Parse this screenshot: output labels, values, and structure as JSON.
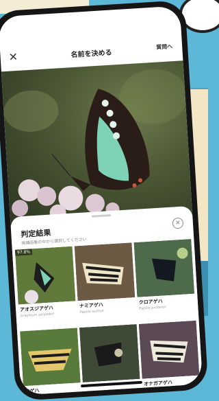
{
  "header": {
    "close_glyph": "✕",
    "title": "名前を決める",
    "question_link": "質問へ"
  },
  "result_panel": {
    "title": "判定結果",
    "subtitle": "候補画像の中から選択してください",
    "close_glyph": "✕"
  },
  "candidates": [
    {
      "rank": "97.8%",
      "name": "アオスジアゲハ",
      "scientific": "Graphium sarpedon",
      "thumb_color": "#5f7a3a"
    },
    {
      "rank": "",
      "name": "ナミアゲハ",
      "scientific": "Papilio xuthus",
      "thumb_color": "#6d5a44"
    },
    {
      "rank": "",
      "name": "クロアゲハ",
      "scientific": "Papilio protenor",
      "thumb_color": "#4d6a4a"
    },
    {
      "rank": "",
      "name": "アゲハ",
      "scientific": "",
      "thumb_color": "#7b6a3b"
    },
    {
      "rank": "",
      "name": "",
      "scientific": "",
      "thumb_color": "#3f4a36"
    },
    {
      "rank": "",
      "name": "オナガアゲハ",
      "scientific": "",
      "thumb_color": "#5b4a56"
    }
  ],
  "colors": {
    "background": "#5cb8d6",
    "phone_frame": "#151515",
    "butterfly_band": "#7ed3b7"
  }
}
